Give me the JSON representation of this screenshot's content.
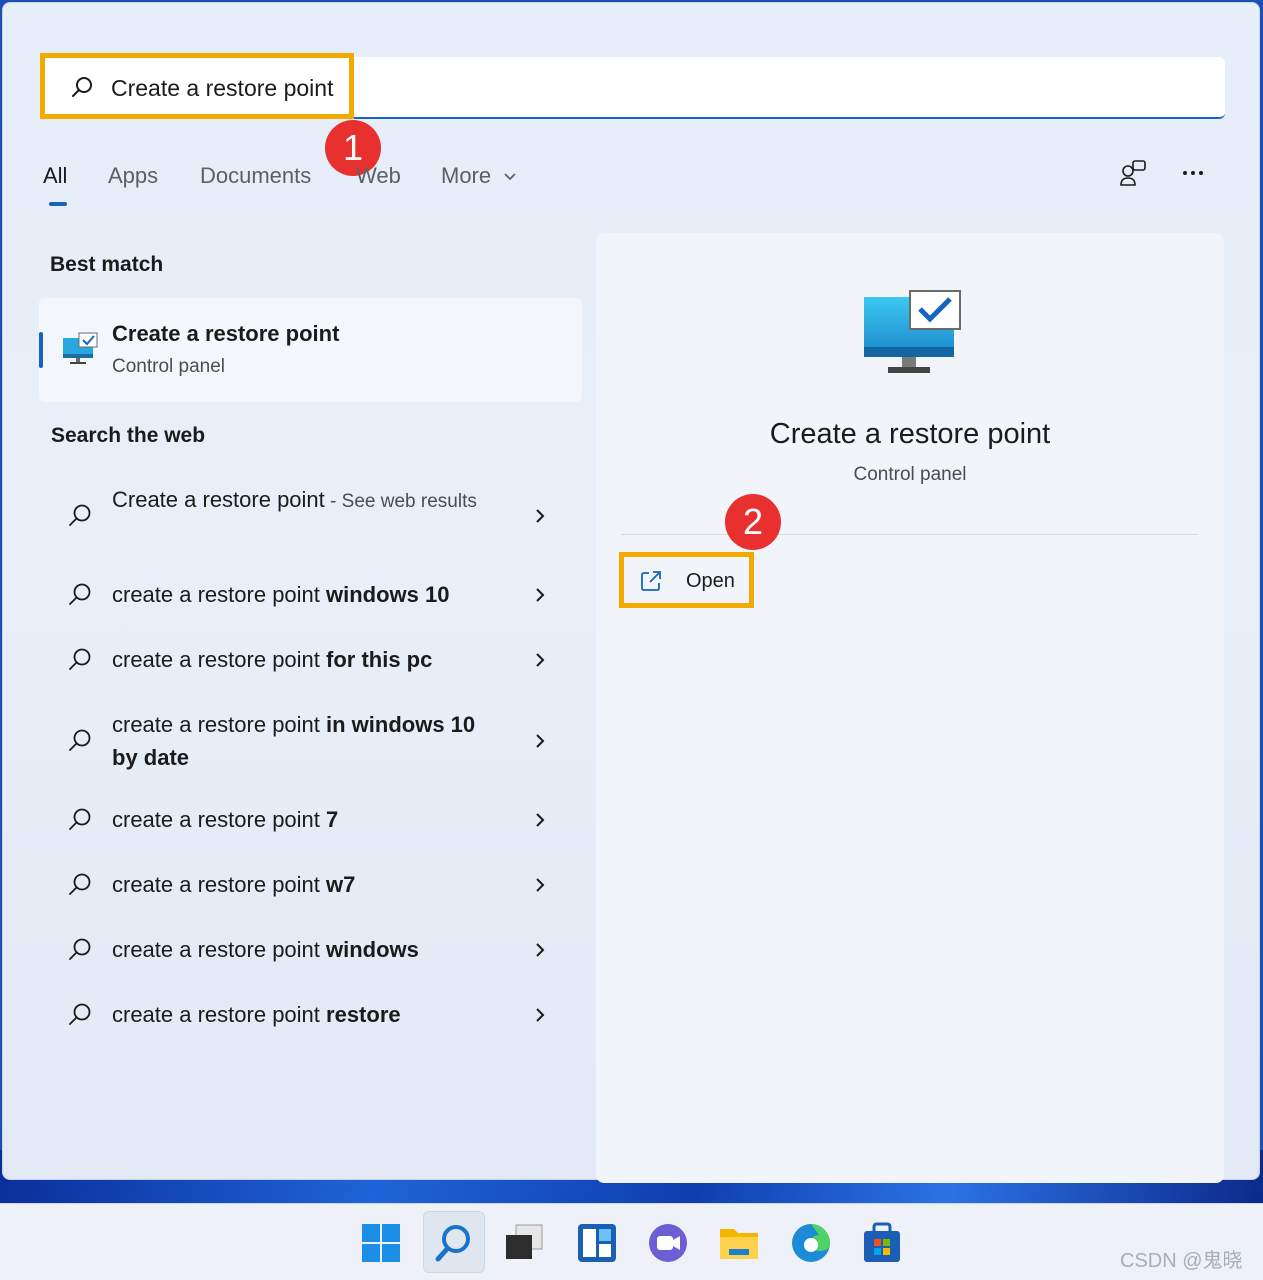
{
  "search": {
    "query": "Create a restore point",
    "icon": "search-icon"
  },
  "callouts": {
    "one": "1",
    "two": "2"
  },
  "tabs": [
    {
      "label": "All",
      "active": true
    },
    {
      "label": "Apps"
    },
    {
      "label": "Documents"
    },
    {
      "label": "Web"
    },
    {
      "label": "More"
    }
  ],
  "best_match": {
    "section_title": "Best match",
    "title": "Create a restore point",
    "subtitle": "Control panel"
  },
  "web": {
    "section_title": "Search the web",
    "items": [
      {
        "plain": "Create a restore point",
        "bold": "",
        "see": " - See web results"
      },
      {
        "plain": "create a restore point ",
        "bold": "windows 10",
        "see": ""
      },
      {
        "plain": "create a restore point ",
        "bold": "for this pc",
        "see": ""
      },
      {
        "plain": "create a restore point ",
        "bold": "in windows 10 by date",
        "see": ""
      },
      {
        "plain": "create a restore point ",
        "bold": "7",
        "see": ""
      },
      {
        "plain": "create a restore point ",
        "bold": "w7",
        "see": ""
      },
      {
        "plain": "create a restore point ",
        "bold": "windows",
        "see": ""
      },
      {
        "plain": "create a restore point ",
        "bold": "restore",
        "see": ""
      }
    ]
  },
  "detail": {
    "title": "Create a restore point",
    "subtitle": "Control panel",
    "open_label": "Open"
  },
  "taskbar": {
    "icons": [
      "windows-start-icon",
      "search-icon",
      "task-view-icon",
      "widgets-icon",
      "teams-chat-icon",
      "file-explorer-icon",
      "edge-browser-icon",
      "microsoft-store-icon"
    ]
  },
  "watermark": "CSDN @鬼晓",
  "colors": {
    "accent": "#1565c0",
    "highlight": "#f2a900",
    "callout": "#e8302f"
  }
}
